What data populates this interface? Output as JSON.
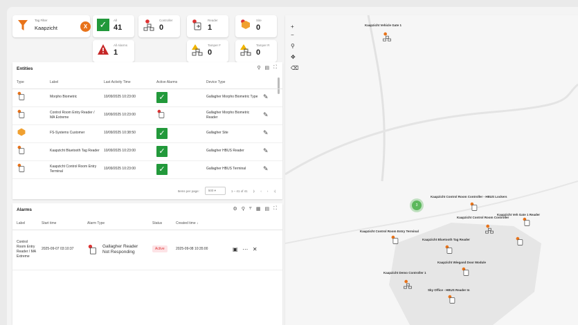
{
  "tag_filter": {
    "label": "Tag Filter",
    "value": "Kaapzicht",
    "clear": "X"
  },
  "stats": [
    {
      "label": "All",
      "value": "41"
    },
    {
      "label": "Controller",
      "value": "0"
    },
    {
      "label": "Reader",
      "value": "1"
    },
    {
      "label": "Site",
      "value": "0"
    },
    {
      "label": "All Alarms",
      "value": "1"
    },
    {
      "label": "Tamper F",
      "value": "0"
    },
    {
      "label": "Tamper R",
      "value": "0"
    }
  ],
  "entities": {
    "title": "Entities",
    "columns": [
      "Type",
      "Label",
      "Last Activity Time",
      "Active Alarms",
      "Device Type"
    ],
    "rows": [
      {
        "label": "Morpho Biometric",
        "time": "10/09/2025 10:23:00",
        "device": "Gallagher Morpho Biometric Type"
      },
      {
        "label": "Control Room Entry Reader / MA Extreme",
        "time": "10/09/2025 10:23:00",
        "device": "Gallagher Morpho Biometric Reader"
      },
      {
        "label": "FS-Systems Customer",
        "time": "10/09/2025 10:38:50",
        "device": "Gallagher Site"
      },
      {
        "label": "Kaapzicht Bluetooth Tag Reader",
        "time": "10/09/2025 10:23:00",
        "device": "Gallagher HBUS Reader"
      },
      {
        "label": "Kaapzicht Control Room Entry Terminal",
        "time": "10/09/2025 10:23:00",
        "device": "Gallagher HBUS Terminal"
      }
    ],
    "items_per_page_label": "Items per page:",
    "items_per_page": "500",
    "range": "1 – 41 of 41"
  },
  "alarms": {
    "title": "Alarms",
    "columns": [
      "Label",
      "Start time",
      "Alarm Type",
      "Status",
      "Created time"
    ],
    "rows": [
      {
        "label": "Control Room Entry Reader / MA Extreme",
        "start": "2025-09-07 03:10:37",
        "type": "Gallagher Reader Not Responding",
        "status": "Active",
        "created": "2025-09-08 10:35:00"
      }
    ]
  },
  "map": {
    "labels": [
      "Kaapzicht Vehicle Gate 1",
      "Kaapzicht Control Room Controller - HBUS Lockers",
      "Kaapzicht Veh Gate 1 Reader",
      "Kaapzicht Control Room Controller",
      "Kaapzicht Control Room Entry Terminal",
      "Kaapzicht Bluetooth Tag Reader",
      "Kaapzicht Wiegand Door Module",
      "Kaapzicht Demo Controller 1",
      "Sky Office - HBUS Reader In"
    ],
    "cluster_count": "3"
  },
  "colors": {
    "accent": "#e8731a",
    "success": "#22993b",
    "danger": "#d33333"
  }
}
